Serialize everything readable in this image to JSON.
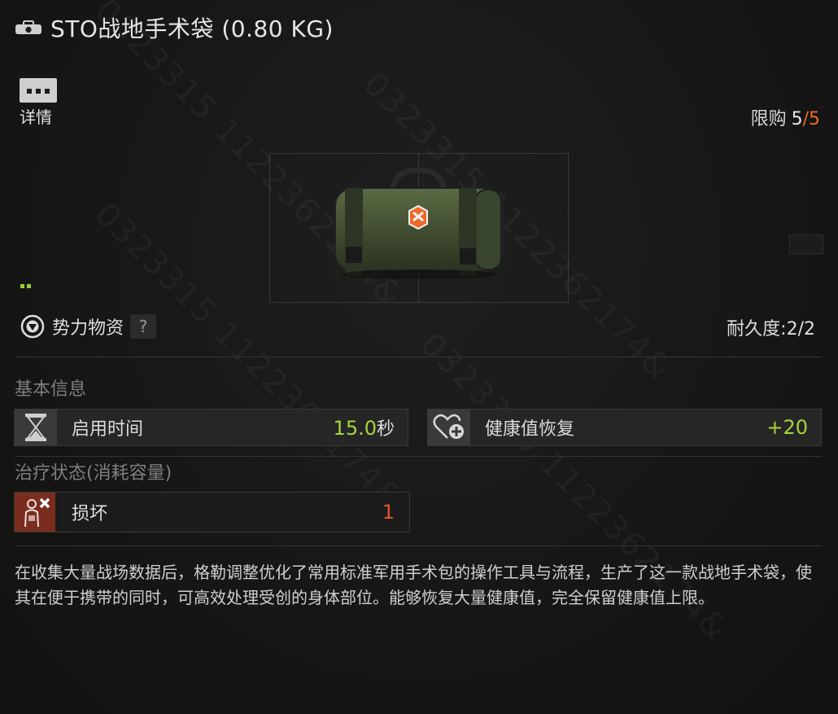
{
  "header": {
    "title": "STO战地手术袋 (0.80 KG)",
    "icon": "medical-bag-icon"
  },
  "details_button": {
    "label": "详情",
    "icon": "more-dots-icon"
  },
  "purchase_limit": {
    "label": "限购",
    "current": "5",
    "separator": "/",
    "max": "5"
  },
  "item_image": {
    "icon": "surgical-kit-icon",
    "accent_color": "#ee6a2a"
  },
  "rarity": {
    "color": "#9bd236"
  },
  "faction": {
    "label": "势力物资",
    "help": "?",
    "icon": "faction-emblem-icon"
  },
  "durability": {
    "label": "耐久度:",
    "value": "2/2"
  },
  "basic_info": {
    "title": "基本信息",
    "stats": [
      {
        "label": "启用时间",
        "value": "15.0",
        "unit": "秒",
        "icon": "hourglass-icon"
      },
      {
        "label": "健康值恢复",
        "value": "+20",
        "unit": "",
        "icon": "heart-plus-icon"
      }
    ]
  },
  "treatment": {
    "title": "治疗状态(消耗容量)",
    "items": [
      {
        "label": "损坏",
        "value": "1",
        "icon": "damaged-body-icon"
      }
    ]
  },
  "description": "在收集大量战场数据后，格勒调整优化了常用标准军用手术包的操作工具与流程，生产了这一款战地手术袋，使其在便于携带的同时，可高效处理受创的身体部位。能够恢复大量健康值，完全保留健康值上限。",
  "watermark": "0323315 1122362174&",
  "colors": {
    "positive": "#a8d43a",
    "negative": "#e2552a",
    "accent": "#ee6a2a"
  }
}
